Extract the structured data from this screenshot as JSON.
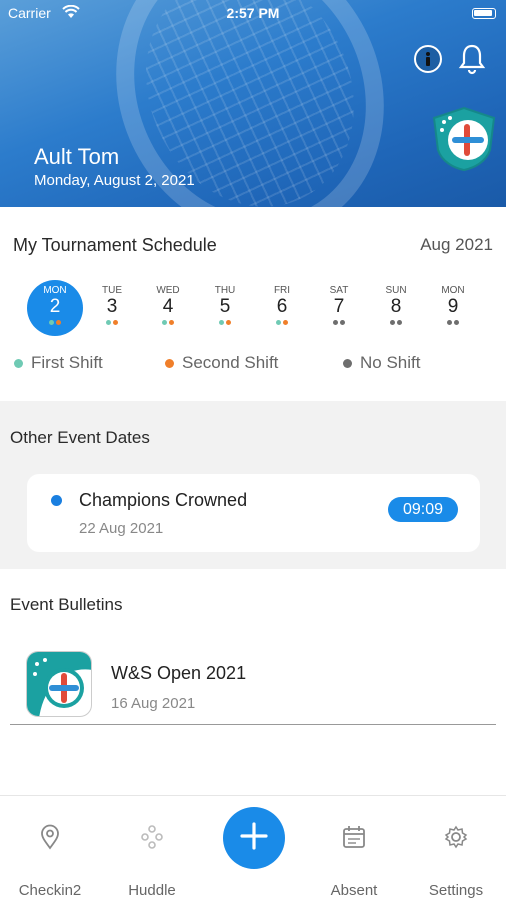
{
  "status_bar": {
    "carrier": "Carrier",
    "time": "2:57 PM"
  },
  "header": {
    "user_name": "Ault Tom",
    "date": "Monday, August 2, 2021"
  },
  "schedule": {
    "title": "My Tournament Schedule",
    "month": "Aug 2021",
    "days": [
      {
        "name": "MON",
        "num": "2",
        "dots": [
          "first",
          "second"
        ],
        "selected": true
      },
      {
        "name": "TUE",
        "num": "3",
        "dots": [
          "first",
          "second"
        ]
      },
      {
        "name": "WED",
        "num": "4",
        "dots": [
          "first",
          "second"
        ]
      },
      {
        "name": "THU",
        "num": "5",
        "dots": [
          "first",
          "second"
        ]
      },
      {
        "name": "FRI",
        "num": "6",
        "dots": [
          "first",
          "second"
        ]
      },
      {
        "name": "SAT",
        "num": "7",
        "dots": [
          "none",
          "none"
        ]
      },
      {
        "name": "SUN",
        "num": "8",
        "dots": [
          "none",
          "none"
        ]
      },
      {
        "name": "MON",
        "num": "9",
        "dots": [
          "none",
          "none"
        ]
      }
    ],
    "legend": {
      "first": "First Shift",
      "second": "Second Shift",
      "none": "No Shift"
    }
  },
  "colors": {
    "accent": "#1a8be8",
    "first_shift": "#6fcab4",
    "second_shift": "#f07f2a",
    "no_shift": "#6e6e6e"
  },
  "other_events": {
    "title": "Other Event Dates",
    "items": [
      {
        "title": "Champions Crowned",
        "date": "22 Aug 2021",
        "time": "09:09"
      }
    ]
  },
  "bulletins": {
    "title": "Event Bulletins",
    "items": [
      {
        "name": "W&S Open 2021",
        "date": "16 Aug 2021"
      }
    ]
  },
  "tabbar": {
    "tabs": [
      {
        "label": "Checkin2",
        "icon": "location-pin-icon"
      },
      {
        "label": "Huddle",
        "icon": "network-icon"
      },
      {
        "label": "Absent",
        "icon": "calendar-icon"
      },
      {
        "label": "Settings",
        "icon": "gear-icon"
      }
    ],
    "fab_icon": "plus-icon"
  }
}
